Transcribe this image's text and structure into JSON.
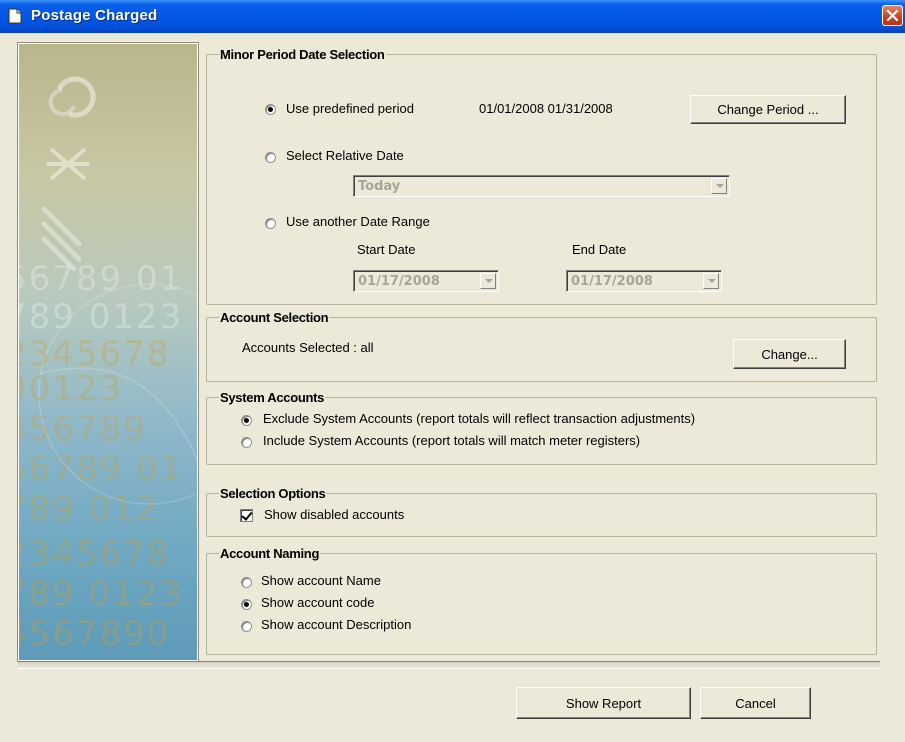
{
  "window": {
    "title": "Postage Charged"
  },
  "minor_period": {
    "legend": "Minor Period Date Selection",
    "predefined_label": "Use predefined period",
    "predefined_selected": true,
    "predefined_dates": "01/01/2008 01/31/2008",
    "change_period_label": "Change Period ...",
    "relative_label": "Select Relative Date",
    "relative_selected": false,
    "relative_value": "Today",
    "range_label": "Use another Date Range",
    "range_selected": false,
    "start_label": "Start Date",
    "end_label": "End Date",
    "start_value": "01/17/2008",
    "end_value": "01/17/2008"
  },
  "account_selection": {
    "legend": "Account Selection",
    "selected_text": "Accounts Selected : all",
    "change_label": "Change..."
  },
  "system_accounts": {
    "legend": "System Accounts",
    "options": [
      {
        "label": "Exclude System Accounts (report totals will reflect transaction adjustments)",
        "checked": true
      },
      {
        "label": "Include System Accounts (report totals will match  meter registers)",
        "checked": false
      }
    ]
  },
  "selection_options": {
    "legend": "Selection Options",
    "show_disabled_label": "Show disabled accounts",
    "show_disabled_checked": true
  },
  "account_naming": {
    "legend": "Account Naming",
    "options": [
      {
        "label": "Show account Name",
        "checked": false
      },
      {
        "label": "Show account code",
        "checked": true
      },
      {
        "label": "Show account Description",
        "checked": false
      }
    ]
  },
  "footer": {
    "show_report_label": "Show Report",
    "cancel_label": "Cancel"
  },
  "colors": {
    "titlebar": "#0058e6",
    "dialog_bg": "#ECE9D8",
    "disabled_text": "#a7a596"
  },
  "icons": {
    "window_icon": "document-icon",
    "close": "close-icon"
  }
}
